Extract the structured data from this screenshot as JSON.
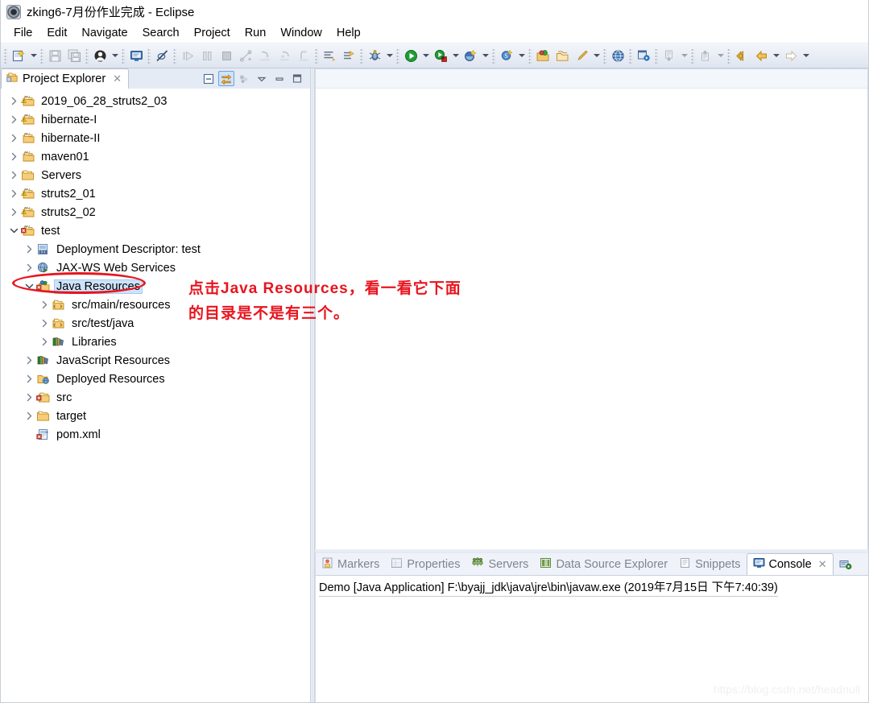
{
  "window": {
    "title": "zking6-7月份作业完成 - Eclipse",
    "app_icon": "eclipse-icon"
  },
  "menubar": {
    "items": [
      "File",
      "Edit",
      "Navigate",
      "Search",
      "Project",
      "Run",
      "Window",
      "Help"
    ]
  },
  "toolbar": {
    "groups": [
      {
        "buttons": [
          "new-wizard-icon"
        ],
        "arrow_after": true
      },
      {
        "buttons": [
          "save-icon",
          "save-all-icon"
        ],
        "arrow_after": false
      },
      {
        "buttons": [
          "user-icon"
        ],
        "arrow_after": true
      },
      {
        "buttons": [
          "open-console-icon"
        ],
        "arrow_after": false
      },
      {
        "buttons": [
          "skip-breakpoints-icon"
        ],
        "arrow_after": false
      },
      {
        "buttons": [
          "resume-icon",
          "suspend-icon",
          "terminate-icon",
          "disconnect-icon",
          "step-into-icon",
          "step-over-icon",
          "step-return-icon"
        ],
        "arrow_after": false
      },
      {
        "buttons": [
          "show-whitespace-icon",
          "next-annotation-icon"
        ],
        "arrow_after": false
      },
      {
        "buttons": [
          "debug-icon"
        ],
        "arrow_after": true
      },
      {
        "buttons": [
          "run-icon"
        ],
        "arrow_after": true
      },
      {
        "buttons": [
          "run-as-server-icon"
        ],
        "arrow_after": true
      },
      {
        "buttons": [
          "external-tools-icon"
        ],
        "arrow_after": true
      },
      {
        "buttons": [
          "search-icon"
        ],
        "arrow_after": true
      },
      {
        "buttons": [
          "open-type-icon",
          "open-task-icon",
          "new-java-class-icon"
        ],
        "arrow_after": true
      },
      {
        "buttons": [
          "open-web-browser-icon"
        ],
        "arrow_after": false
      },
      {
        "buttons": [
          "open-perspective-icon"
        ],
        "arrow_after": false
      },
      {
        "buttons": [
          "next-edit-icon"
        ],
        "arrow_after": true
      },
      {
        "buttons": [
          "previous-edit-icon"
        ],
        "arrow_after": true
      },
      {
        "buttons": [
          "back-history-icon",
          "back-icon"
        ],
        "arrow_after": true
      },
      {
        "buttons": [
          "forward-icon"
        ],
        "arrow_after": true
      }
    ]
  },
  "project_explorer": {
    "tab_label": "Project Explorer",
    "tab_icon": "project-explorer-icon",
    "close_glyph": "✕",
    "tools": [
      "collapse-all-icon",
      "link-with-editor-icon",
      "focus-on-active-task-icon",
      "view-menu-icon",
      "minimize-icon",
      "maximize-icon"
    ],
    "tree": [
      {
        "label": "2019_06_28_struts2_03",
        "indent": 0,
        "twisty": "collapsed",
        "icon": "maven-project-warning-icon",
        "selected": false
      },
      {
        "label": "hibernate-I",
        "indent": 0,
        "twisty": "collapsed",
        "icon": "maven-project-warning-icon",
        "selected": false
      },
      {
        "label": "hibernate-II",
        "indent": 0,
        "twisty": "collapsed",
        "icon": "maven-project-icon",
        "selected": false
      },
      {
        "label": "maven01",
        "indent": 0,
        "twisty": "collapsed",
        "icon": "maven-project-icon",
        "selected": false
      },
      {
        "label": "Servers",
        "indent": 0,
        "twisty": "collapsed",
        "icon": "folder-icon",
        "selected": false
      },
      {
        "label": "struts2_01",
        "indent": 0,
        "twisty": "collapsed",
        "icon": "maven-project-warning-icon",
        "selected": false
      },
      {
        "label": "struts2_02",
        "indent": 0,
        "twisty": "collapsed",
        "icon": "maven-project-warning-icon",
        "selected": false
      },
      {
        "label": "test",
        "indent": 0,
        "twisty": "expanded",
        "icon": "maven-project-error-icon",
        "selected": false
      },
      {
        "label": "Deployment Descriptor: test",
        "indent": 1,
        "twisty": "collapsed",
        "icon": "deployment-descriptor-icon",
        "selected": false
      },
      {
        "label": "JAX-WS Web Services",
        "indent": 1,
        "twisty": "collapsed",
        "icon": "jax-ws-icon",
        "selected": false
      },
      {
        "label": "Java Resources",
        "indent": 1,
        "twisty": "expanded",
        "icon": "java-resources-error-icon",
        "selected": true
      },
      {
        "label": "src/main/resources",
        "indent": 2,
        "twisty": "collapsed",
        "icon": "source-folder-icon",
        "selected": false
      },
      {
        "label": "src/test/java",
        "indent": 2,
        "twisty": "collapsed",
        "icon": "source-folder-icon",
        "selected": false
      },
      {
        "label": "Libraries",
        "indent": 2,
        "twisty": "collapsed",
        "icon": "libraries-icon",
        "selected": false
      },
      {
        "label": "JavaScript Resources",
        "indent": 1,
        "twisty": "collapsed",
        "icon": "javascript-resources-icon",
        "selected": false
      },
      {
        "label": "Deployed Resources",
        "indent": 1,
        "twisty": "collapsed",
        "icon": "deployed-resources-icon",
        "selected": false
      },
      {
        "label": "src",
        "indent": 1,
        "twisty": "collapsed",
        "icon": "folder-error-icon",
        "selected": false
      },
      {
        "label": "target",
        "indent": 1,
        "twisty": "collapsed",
        "icon": "folder-icon",
        "selected": false
      },
      {
        "label": "pom.xml",
        "indent": 1,
        "twisty": "none",
        "icon": "pom-xml-error-icon",
        "selected": false
      }
    ]
  },
  "bottom_panel": {
    "tabs": [
      {
        "label": "Markers",
        "icon": "markers-icon",
        "active": false,
        "closable": false
      },
      {
        "label": "Properties",
        "icon": "properties-icon",
        "active": false,
        "closable": false
      },
      {
        "label": "Servers",
        "icon": "servers-icon",
        "active": false,
        "closable": false
      },
      {
        "label": "Data Source Explorer",
        "icon": "data-source-explorer-icon",
        "active": false,
        "closable": false
      },
      {
        "label": "Snippets",
        "icon": "snippets-icon",
        "active": false,
        "closable": false
      },
      {
        "label": "Console",
        "icon": "console-icon",
        "active": true,
        "closable": true
      }
    ],
    "close_glyph": "✕",
    "overflow_icon": "console-extra-icon",
    "console_line": "Demo [Java Application] F:\\byajj_jdk\\java\\jre\\bin\\javaw.exe (2019年7月15日 下午7:40:39)"
  },
  "annotations": {
    "text_line_1": "点击Java Resources，看一看它下面",
    "text_line_2": "的目录是不是有三个。",
    "highlight_color": "#e8141e",
    "ellipse_target": "java-resources-row"
  },
  "watermark": "https://blog.csdn.net/headnull"
}
